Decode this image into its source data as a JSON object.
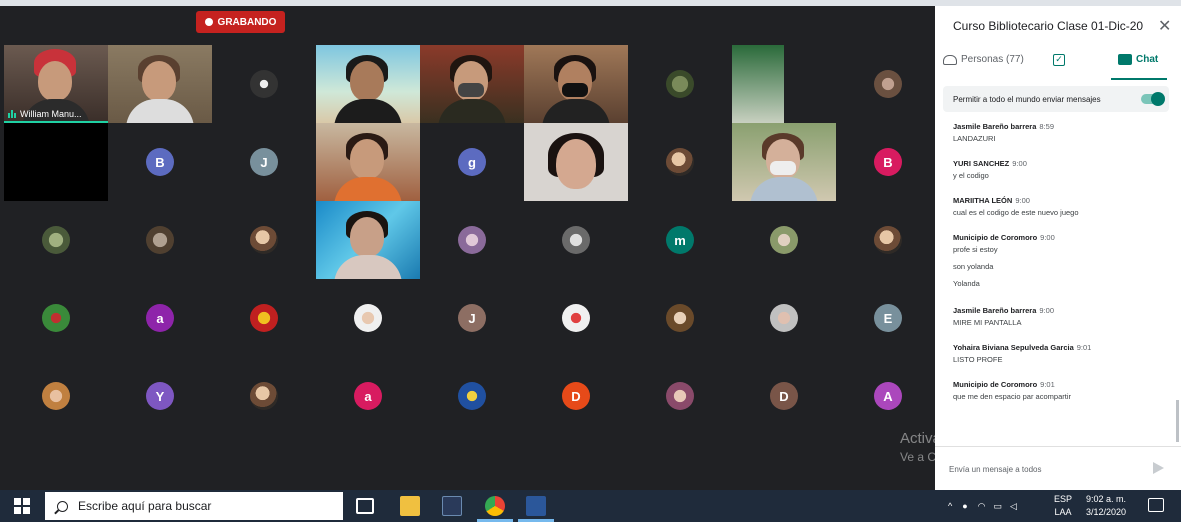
{
  "meet": {
    "recording_label": "GRABANDO",
    "featured_speaker": "William Manu...",
    "avatars": {
      "b1": "B",
      "j1": "J",
      "g1": "g",
      "b2": "B",
      "m1": "m",
      "a1": "a",
      "j2": "J",
      "e1": "E",
      "y1": "Y",
      "a2": "a",
      "d1": "D",
      "d2": "D",
      "a3": "A"
    }
  },
  "panel": {
    "title": "Curso Bibliotecario Clase 01-Dic-20",
    "tabs": {
      "people": "Personas (77)",
      "chat": "Chat"
    },
    "allow_all": "Permitir a todo el mundo enviar mensajes",
    "messages": [
      {
        "author": "Jasmile Bareño barrera",
        "time": "8:59",
        "lines": [
          "LANDAZURI"
        ]
      },
      {
        "author": "YURI SANCHEZ",
        "time": "9:00",
        "lines": [
          "y el codigo"
        ]
      },
      {
        "author": "MARIITHA LEÓN",
        "time": "9:00",
        "lines": [
          "cual es el codigo de este nuevo juego"
        ]
      },
      {
        "author": "Municipio de Coromoro",
        "time": "9:00",
        "lines": [
          "profe si estoy",
          "son yolanda",
          "Yolanda"
        ]
      },
      {
        "author": "Jasmile Bareño barrera",
        "time": "9:00",
        "lines": [
          "MIRE MI PANTALLA"
        ]
      },
      {
        "author": "Yohaira Biviana Sepulveda Garcia",
        "time": "9:01",
        "lines": [
          "LISTO PROFE"
        ]
      },
      {
        "author": "Municipio de Coromoro",
        "time": "9:01",
        "lines": [
          "que me den espacio par acompartir"
        ]
      }
    ],
    "send_placeholder": "Envía un mensaje a todos"
  },
  "watermark": {
    "line1": "Activar Windows",
    "line2": "Ve a Configuración para activar Windows."
  },
  "taskbar": {
    "search_placeholder": "Escribe aquí para buscar",
    "lang_top": "ESP",
    "lang_bottom": "LAA",
    "time": "9:02 a. m.",
    "date": "3/12/2020"
  },
  "colors": {
    "recording": "#c5221f",
    "accent": "#00796b",
    "speaking": "#1fd1a3",
    "meet_bg": "#202124",
    "taskbar": "#1f2b3b"
  }
}
